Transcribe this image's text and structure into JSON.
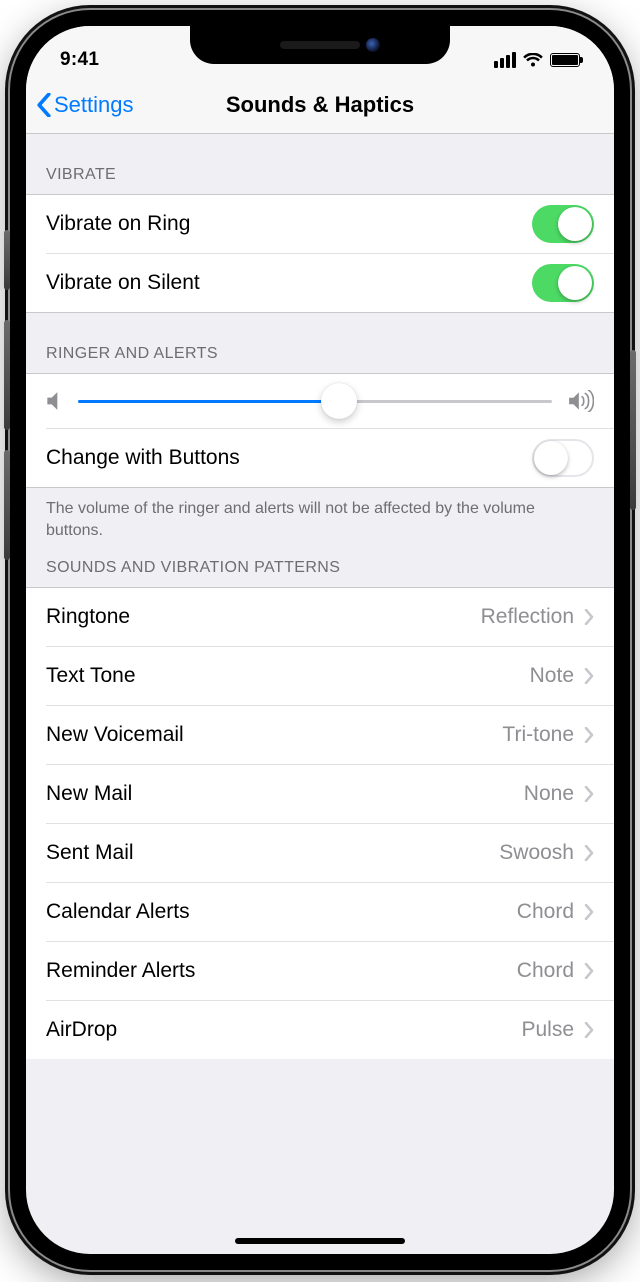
{
  "status": {
    "time": "9:41"
  },
  "nav": {
    "back_label": "Settings",
    "title": "Sounds & Haptics"
  },
  "sections": {
    "vibrate": {
      "header": "VIBRATE",
      "ring_label": "Vibrate on Ring",
      "ring_on": true,
      "silent_label": "Vibrate on Silent",
      "silent_on": true
    },
    "ringer": {
      "header": "RINGER AND ALERTS",
      "volume_pct": 55,
      "change_label": "Change with Buttons",
      "change_on": false,
      "footer": "The volume of the ringer and alerts will not be affected by the volume buttons."
    },
    "patterns": {
      "header": "SOUNDS AND VIBRATION PATTERNS",
      "items": [
        {
          "label": "Ringtone",
          "value": "Reflection"
        },
        {
          "label": "Text Tone",
          "value": "Note"
        },
        {
          "label": "New Voicemail",
          "value": "Tri-tone"
        },
        {
          "label": "New Mail",
          "value": "None"
        },
        {
          "label": "Sent Mail",
          "value": "Swoosh"
        },
        {
          "label": "Calendar Alerts",
          "value": "Chord"
        },
        {
          "label": "Reminder Alerts",
          "value": "Chord"
        },
        {
          "label": "AirDrop",
          "value": "Pulse"
        }
      ]
    }
  }
}
